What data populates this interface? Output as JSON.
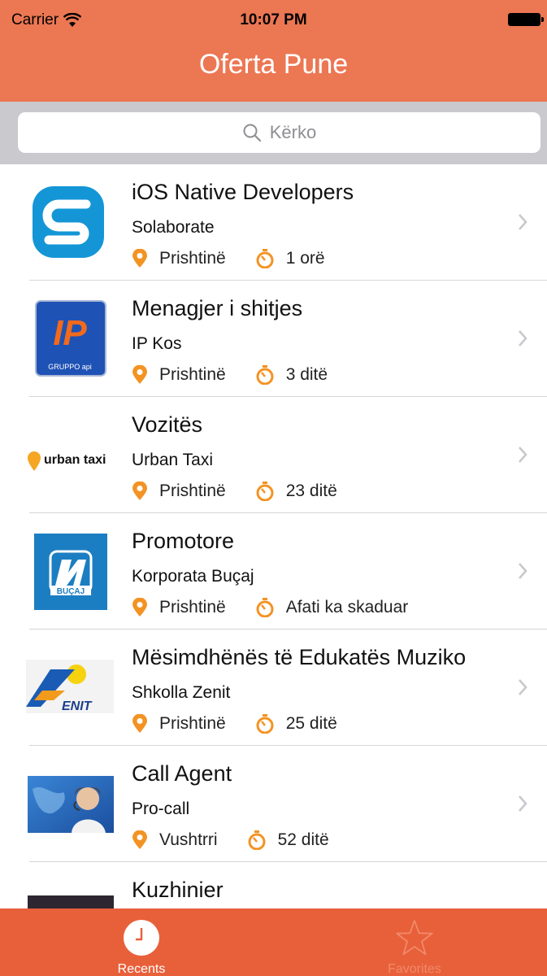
{
  "status_bar": {
    "carrier": "Carrier",
    "time": "10:07 PM"
  },
  "nav": {
    "title": "Oferta Pune"
  },
  "search": {
    "placeholder": "Kërko"
  },
  "colors": {
    "header": "#EC7753",
    "tabbar": "#E8603A",
    "pin": "#F39323",
    "timer": "#F39323"
  },
  "jobs": [
    {
      "title": "iOS Native Developers",
      "company": "Solaborate",
      "location": "Prishtinë",
      "time": "1 orë",
      "logo": "solaborate-logo"
    },
    {
      "title": "Menagjer i shitjes",
      "company": "IP Kos",
      "location": "Prishtinë",
      "time": "3 ditë",
      "logo": "ip-logo",
      "logo_text": "IP",
      "logo_sub": "GRUPPO api"
    },
    {
      "title": "Vozitës",
      "company": "Urban Taxi",
      "location": "Prishtinë",
      "time": "23 ditë",
      "logo": "urban-taxi-logo",
      "logo_text": "urban taxi"
    },
    {
      "title": "Promotore",
      "company": "Korporata Buçaj",
      "location": "Prishtinë",
      "time": "Afati ka skaduar",
      "logo": "bucaj-logo",
      "logo_text": "BUÇAJ"
    },
    {
      "title": "Mësimdhënës të Edukatës Muziko",
      "company": "Shkolla Zenit",
      "location": "Prishtinë",
      "time": "25 ditë",
      "logo": "zenit-logo",
      "logo_text": "ENIT"
    },
    {
      "title": "Call Agent",
      "company": "Pro-call",
      "location": "Vushtrri",
      "time": "52 ditë",
      "logo": "procall-photo"
    },
    {
      "title": "Kuzhinier",
      "company": "",
      "location": "",
      "time": "",
      "logo": "kuzhinier-logo"
    }
  ],
  "tabs": [
    {
      "label": "Recents",
      "icon": "clock-icon",
      "selected": true
    },
    {
      "label": "Favorites",
      "icon": "star-icon",
      "selected": false
    }
  ]
}
